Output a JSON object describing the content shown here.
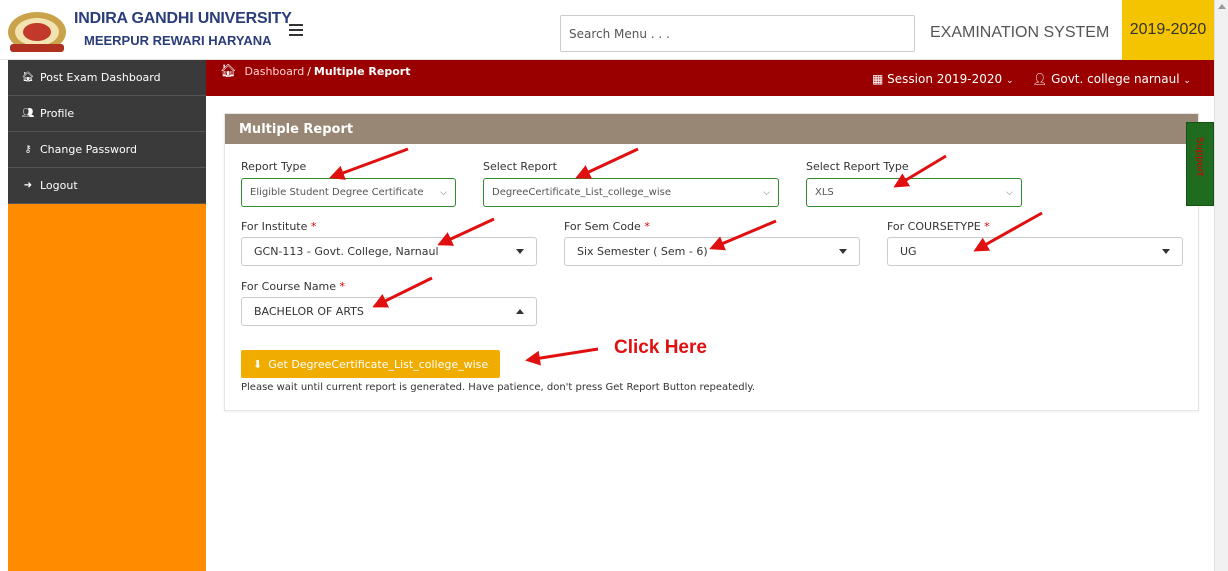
{
  "header": {
    "university_line1": "INDIRA GANDHI UNIVERSITY",
    "university_line2": "MEERPUR REWARI HARYANA",
    "search_placeholder": "Search Menu . . .",
    "system_title": "EXAMINATION SYSTEM",
    "year": "2019-2020"
  },
  "sidebar": {
    "items": [
      {
        "label": "Post Exam Dashboard",
        "icon": "home-icon"
      },
      {
        "label": "Profile",
        "icon": "users-icon"
      },
      {
        "label": "Change Password",
        "icon": "key-icon"
      },
      {
        "label": "Logout",
        "icon": "logout-icon"
      }
    ]
  },
  "topbar": {
    "breadcrumb_link": "Dashboard",
    "breadcrumb_sep": "/",
    "breadcrumb_current": "Multiple Report",
    "session": "Session  2019-2020",
    "user": "Govt. college narnaul"
  },
  "panel": {
    "title": "Multiple Report",
    "report_type_label": "Report Type",
    "report_type_value": "Eligible Student Degree Certificate",
    "select_report_label": "Select Report",
    "select_report_value": "DegreeCertificate_List_college_wise",
    "select_report_type_label": "Select Report Type",
    "select_report_type_value": "XLS",
    "institute_label": "For Institute",
    "institute_value": "GCN-113 - Govt. College, Narnaul",
    "sem_label": "For Sem Code",
    "sem_value": "Six Semester ( Sem - 6)",
    "coursetype_label": "For COURSETYPE",
    "coursetype_value": "UG",
    "course_name_label": "For Course Name",
    "course_name_value": "BACHELOR OF ARTS",
    "required_mark": "*",
    "button_label": "Get DegreeCertificate_List_college_wise",
    "note": "Please wait until current report is generated. Have patience, don't press Get Report Button repeatedly."
  },
  "support_label": "Support",
  "annotation": {
    "click_here": "Click Here",
    "arrow_color": "#e01010"
  },
  "colors": {
    "sidebar_bg": "#ff8c00",
    "sidebar_item_bg": "#3a3a3a",
    "mainbar_bg": "#9b0000",
    "panel_head_bg": "#978774",
    "year_badge_bg": "#f5c400",
    "button_bg": "#f0ad00"
  }
}
